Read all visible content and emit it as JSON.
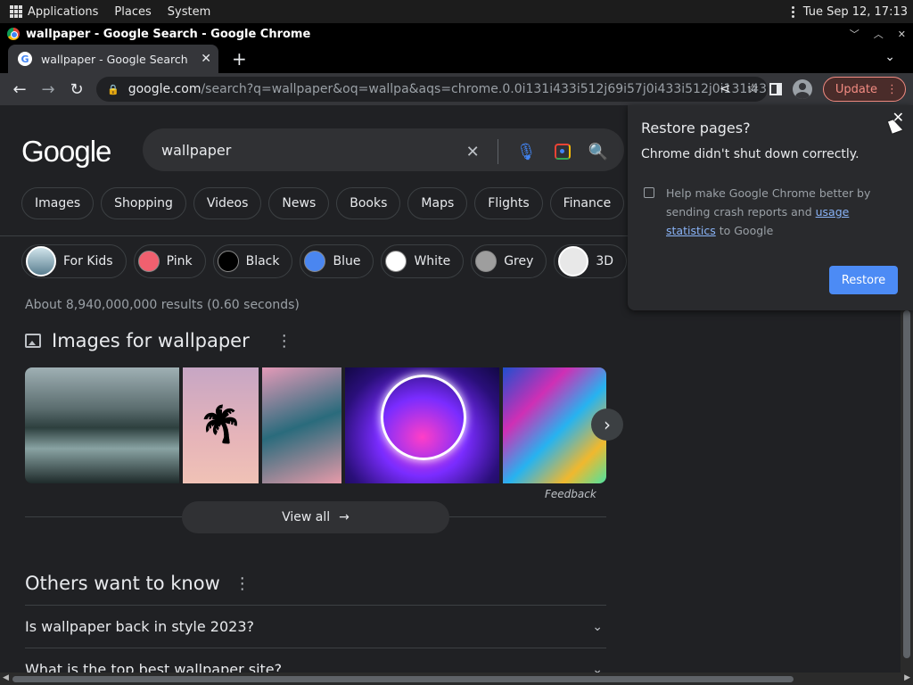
{
  "system_bar": {
    "menus": [
      "Applications",
      "Places",
      "System"
    ],
    "datetime": "Tue Sep 12, 17:13"
  },
  "window": {
    "title": "wallpaper - Google Search - Google Chrome"
  },
  "tab": {
    "title": "wallpaper - Google Search"
  },
  "toolbar": {
    "url_host": "google.com",
    "url_path": "/search?q=wallpaper&oq=wallpa&aqs=chrome.0.0i131i433i512j69i57j0i433i512j0i131i433i...",
    "update_label": "Update"
  },
  "search": {
    "logo": "Google",
    "query": "wallpaper"
  },
  "filters": [
    "Images",
    "Shopping",
    "Videos",
    "News",
    "Books",
    "Maps",
    "Flights",
    "Finance"
  ],
  "refinements": [
    {
      "label": "For Kids",
      "color": "#6a8ca0"
    },
    {
      "label": "Pink",
      "color": "#f0606f"
    },
    {
      "label": "Black",
      "color": "#000000"
    },
    {
      "label": "Blue",
      "color": "#4a86f0"
    },
    {
      "label": "White",
      "color": "#ffffff"
    },
    {
      "label": "Grey",
      "color": "#9e9e9e"
    },
    {
      "label": "3D",
      "color": "#e8e8e8"
    }
  ],
  "results_stats": "About 8,940,000,000 results (0.60 seconds)",
  "images_section": {
    "heading": "Images for wallpaper",
    "feedback": "Feedback",
    "view_all": "View all"
  },
  "others_want_to_know": {
    "heading": "Others want to know",
    "questions": [
      "Is wallpaper back in style 2023?",
      "What is the top best wallpaper site?"
    ]
  },
  "restore_popup": {
    "title": "Restore pages?",
    "message": "Chrome didn't shut down correctly.",
    "help_prefix": "Help make Google Chrome better by sending crash reports and ",
    "help_link": "usage statistics",
    "help_suffix": " to Google",
    "restore_label": "Restore"
  }
}
